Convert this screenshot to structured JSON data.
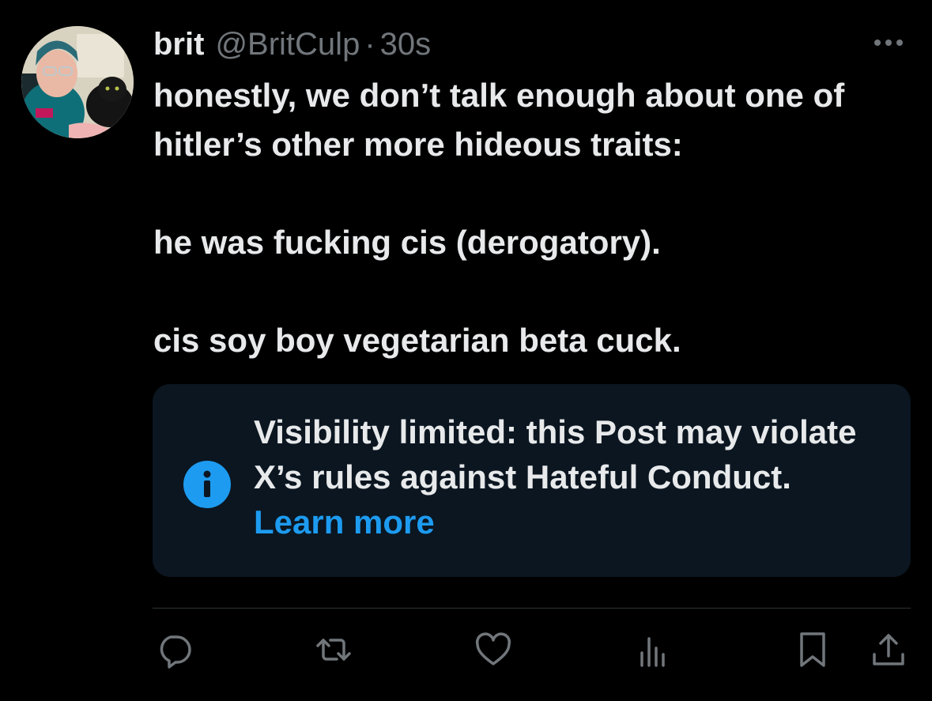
{
  "post": {
    "author": {
      "display_name": "brit",
      "handle": "@BritCulp",
      "separator": "·",
      "timestamp": "30s",
      "avatar_icon": "user-avatar-photo"
    },
    "more_icon": "more-horizontal-icon",
    "text_paragraphs": [
      "honestly, we don’t talk enough about one of hitler’s other more hideous traits:",
      "he was fucking cis (derogatory).",
      "cis soy boy vegetarian beta cuck."
    ],
    "notice": {
      "icon": "info-icon",
      "message": "Visibility limited: this Post may violate X’s rules against Hateful Conduct.",
      "link_label": "Learn more"
    },
    "actions": [
      {
        "name": "reply",
        "icon": "reply-icon"
      },
      {
        "name": "repost",
        "icon": "repost-icon"
      },
      {
        "name": "like",
        "icon": "heart-icon"
      },
      {
        "name": "views",
        "icon": "analytics-icon"
      },
      {
        "name": "bookmark",
        "icon": "bookmark-icon"
      },
      {
        "name": "share",
        "icon": "share-icon"
      }
    ]
  },
  "colors": {
    "background": "#000000",
    "text_primary": "#e7e9ea",
    "text_secondary": "#71767b",
    "accent": "#1d9bf0",
    "notice_background": "#0b1621",
    "divider": "#2f3336"
  }
}
